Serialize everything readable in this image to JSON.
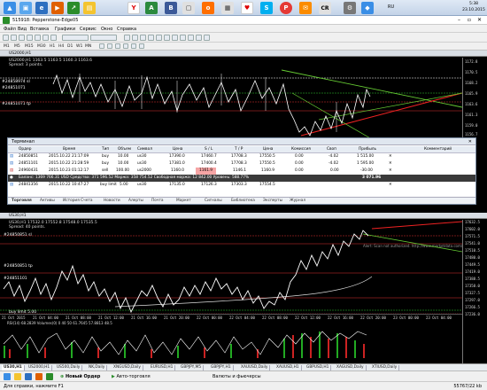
{
  "taskbar": {
    "icons": [
      "Y",
      "A",
      "♥",
      "S",
      "CR"
    ],
    "time": "5:38",
    "date": "23.10.2015",
    "lang": "RU"
  },
  "window": {
    "title": "515918: Pepperstone-Edge05",
    "menu": [
      "Файл",
      "Вид",
      "Вставка",
      "Графики",
      "Сервис",
      "Окно",
      "Справка"
    ]
  },
  "timeframes": [
    "M1",
    "M5",
    "M15",
    "M30",
    "H1",
    "H4",
    "D1",
    "W1",
    "MN"
  ],
  "chart_top": {
    "title": "US2000,H1",
    "info": "US2000,H1  1163.5 1163.5 1160.3 1163.6",
    "spread": "Spread: 3 points.",
    "ticks": [
      "1172.8",
      "1170.5",
      "1168.2",
      "1165.9",
      "1163.6",
      "1161.3",
      "1159.0",
      "1156.7"
    ],
    "labels": [
      "#24858974 sl",
      "#24851071",
      "#24851071 tp"
    ]
  },
  "terminal": {
    "title": "Терминал",
    "columns": [
      "Ордер",
      "Время",
      "Тип",
      "Объем",
      "Символ",
      "Цена",
      "S / L",
      "T / P",
      "Цена",
      "Комиссия",
      "Своп",
      "Прибыль",
      "Комментарий"
    ],
    "rows": [
      [
        "24850851",
        "2015.10.22 21:17:09",
        "buy",
        "10.00",
        "us30",
        "17390.0",
        "17460.7",
        "17708.3",
        "17550.5",
        "0.00",
        "-4.02",
        "1 515.00",
        ""
      ],
      [
        "24851101",
        "2015.10.22 21:28:59",
        "buy",
        "10.00",
        "us30",
        "17381.0",
        "17400.4",
        "17708.3",
        "17550.5",
        "0.00",
        "-4.02",
        "1 595.00",
        ""
      ],
      [
        "24960431",
        "2015.10.23 01:12:17",
        "sell",
        "100.00",
        "us2000",
        "1160.0",
        "1161.9",
        "1146.1",
        "1160.9",
        "0.00",
        "0.00",
        "-30.00",
        ""
      ]
    ],
    "balance_row": {
      "label": "Баланс: 1369 766.31 USD  Средства: 371 596.52  Маржа: 358 754.52  Свободная маржа: 12 842.00  Уровень: 588.77%",
      "total": "3 071.96"
    },
    "pending_row": [
      "24841356",
      "2015.10.22 10:47:27",
      "buy limit",
      "5.00",
      "us30",
      "17135.0",
      "17126.3",
      "17303.3",
      "17554.5",
      "",
      "",
      "",
      ""
    ],
    "tabs": [
      "Торговля",
      "Активы",
      "История Счета",
      "Новости",
      "Алерты",
      "Почта",
      "Маркет",
      "Сигналы",
      "Библиотека",
      "Эксперты",
      "Журнал"
    ]
  },
  "chart_bottom": {
    "title": "US30,H1",
    "info": "US30,H1  17532.0 17552.8 17548.0 17535.5",
    "spread": "Spread: 40 points.",
    "ticks": [
      "17632.5",
      "17602.0",
      "17571.5",
      "17541.0",
      "17510.5",
      "17480.0",
      "17449.5",
      "17419.0",
      "17388.5",
      "17358.0",
      "17327.5",
      "17297.0",
      "17266.5",
      "17236.0"
    ],
    "labels": [
      "#24850851 sl",
      "#24850851 tp",
      "#24851101",
      "buy limit 5.00"
    ],
    "annotation": "Alert: Scan not authorized. http://www.marketdata.com/mt4",
    "indicator": "RSI(14) 68.2839  Volumes(0) 0 40 50 61.7645 57.8813 48.5",
    "dates": [
      "21 Oct 2015",
      "21 Oct 04:00",
      "21 Oct 08:00",
      "21 Oct 12:00",
      "21 Oct 16:00",
      "21 Oct 20:00",
      "22 Oct 00:00",
      "22 Oct 04:00",
      "22 Oct 08:00",
      "22 Oct 12:00",
      "22 Oct 16:00",
      "22 Oct 20:00",
      "23 Oct 00:00",
      "23 Oct 04:00"
    ]
  },
  "chart_tabs": [
    "US30,H1",
    "US2000,H1",
    "US500,Daily",
    "NK,Daily",
    "XNGUSD,Daily",
    "EURUSD,H1",
    "GBPJPY,M5",
    "GBPJPY,H1",
    "XAUUSD,Daily",
    "XAUUSD,H1",
    "GBPUSD,H1",
    "XAGUSD,Daily",
    "XTIUSD,Daily"
  ],
  "bottombar": {
    "new_order": "Новый Ордер",
    "autotrade": "Авто-торговля",
    "center": "Валюты и фьючерсы"
  },
  "status": {
    "left": "Для справки, нажмите F1",
    "right": "55767/22 kb"
  }
}
